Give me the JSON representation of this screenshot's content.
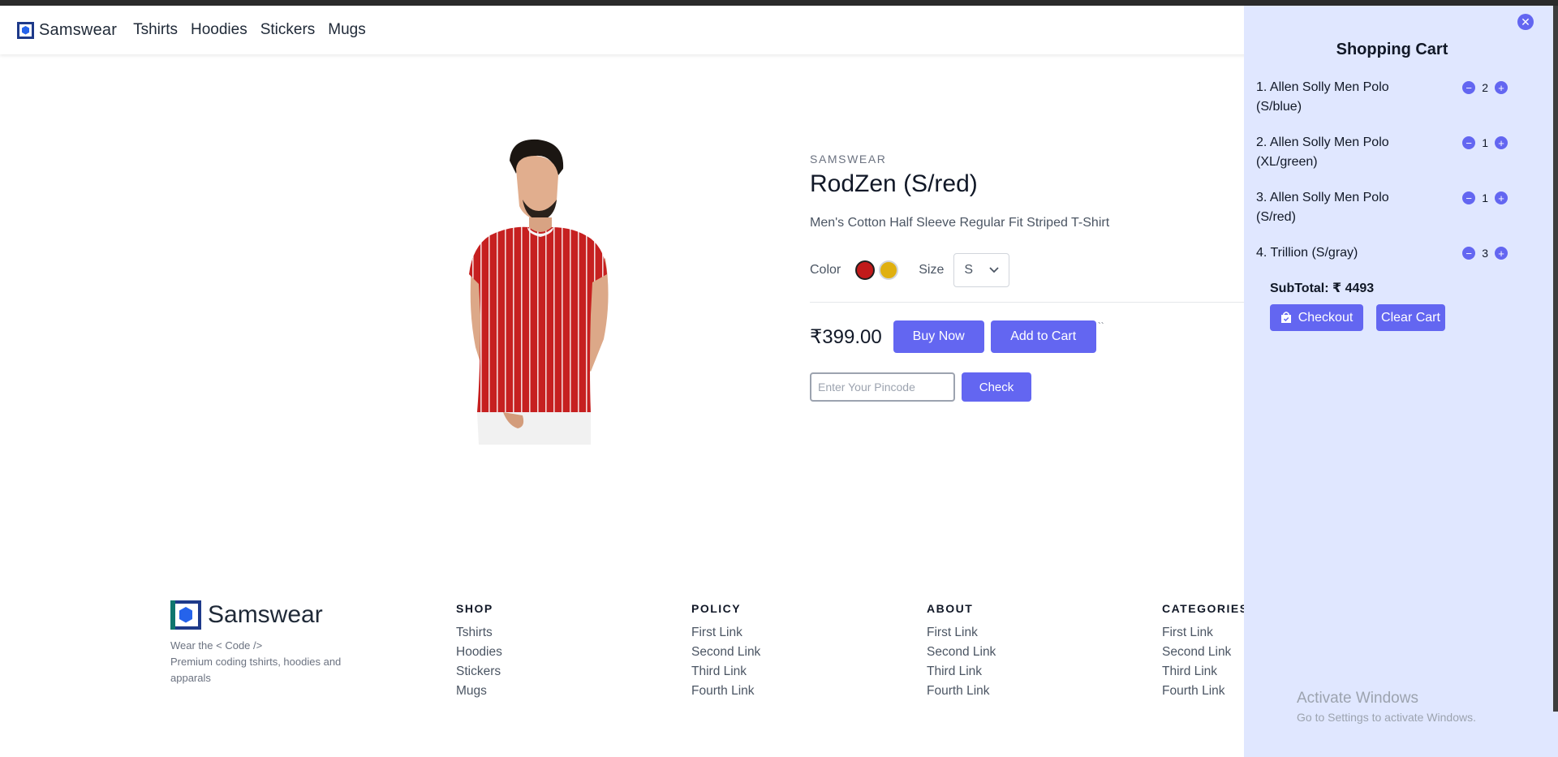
{
  "navbar": {
    "brand": "Samswear",
    "links": [
      "Tshirts",
      "Hoodies",
      "Stickers",
      "Mugs"
    ]
  },
  "product": {
    "brand": "SAMSWEAR",
    "title": "RodZen (S/red)",
    "description": "Men's Cotton Half Sleeve Regular Fit Striped T-Shirt",
    "color_label": "Color",
    "colors": [
      "#c11a1a",
      "#e0b010"
    ],
    "size_label": "Size",
    "size_value": "S",
    "price": "₹399.00",
    "buy_label": "Buy Now",
    "add_label": "Add to Cart",
    "tick_mark": "``",
    "pincode_placeholder": "Enter Your Pincode",
    "check_label": "Check"
  },
  "footer": {
    "brand": "Samswear",
    "tagline1": "Wear the < Code />",
    "tagline2": "Premium coding tshirts, hoodies and apparals",
    "columns": [
      {
        "title": "SHOP",
        "links": [
          "Tshirts",
          "Hoodies",
          "Stickers",
          "Mugs"
        ]
      },
      {
        "title": "POLICY",
        "links": [
          "First Link",
          "Second Link",
          "Third Link",
          "Fourth Link"
        ]
      },
      {
        "title": "ABOUT",
        "links": [
          "First Link",
          "Second Link",
          "Third Link",
          "Fourth Link"
        ]
      },
      {
        "title": "CATEGORIES",
        "links": [
          "First Link",
          "Second Link",
          "Third Link",
          "Fourth Link"
        ]
      }
    ]
  },
  "cart": {
    "title": "Shopping Cart",
    "items": [
      {
        "label": "1. Allen Solly Men Polo (S/blue)",
        "qty": "2"
      },
      {
        "label": "2. Allen Solly Men Polo (XL/green)",
        "qty": "1"
      },
      {
        "label": "3. Allen Solly Men Polo (S/red)",
        "qty": "1"
      },
      {
        "label": "4. Trillion (S/gray)",
        "qty": "3"
      }
    ],
    "subtotal": "SubTotal: ₹ 4493",
    "checkout_label": "Checkout",
    "clear_label": "Clear Cart",
    "close_icon": "close-icon"
  },
  "watermark": {
    "line1": "Activate Windows",
    "line2": "Go to Settings to activate Windows."
  },
  "accent_color": "#6366f1"
}
